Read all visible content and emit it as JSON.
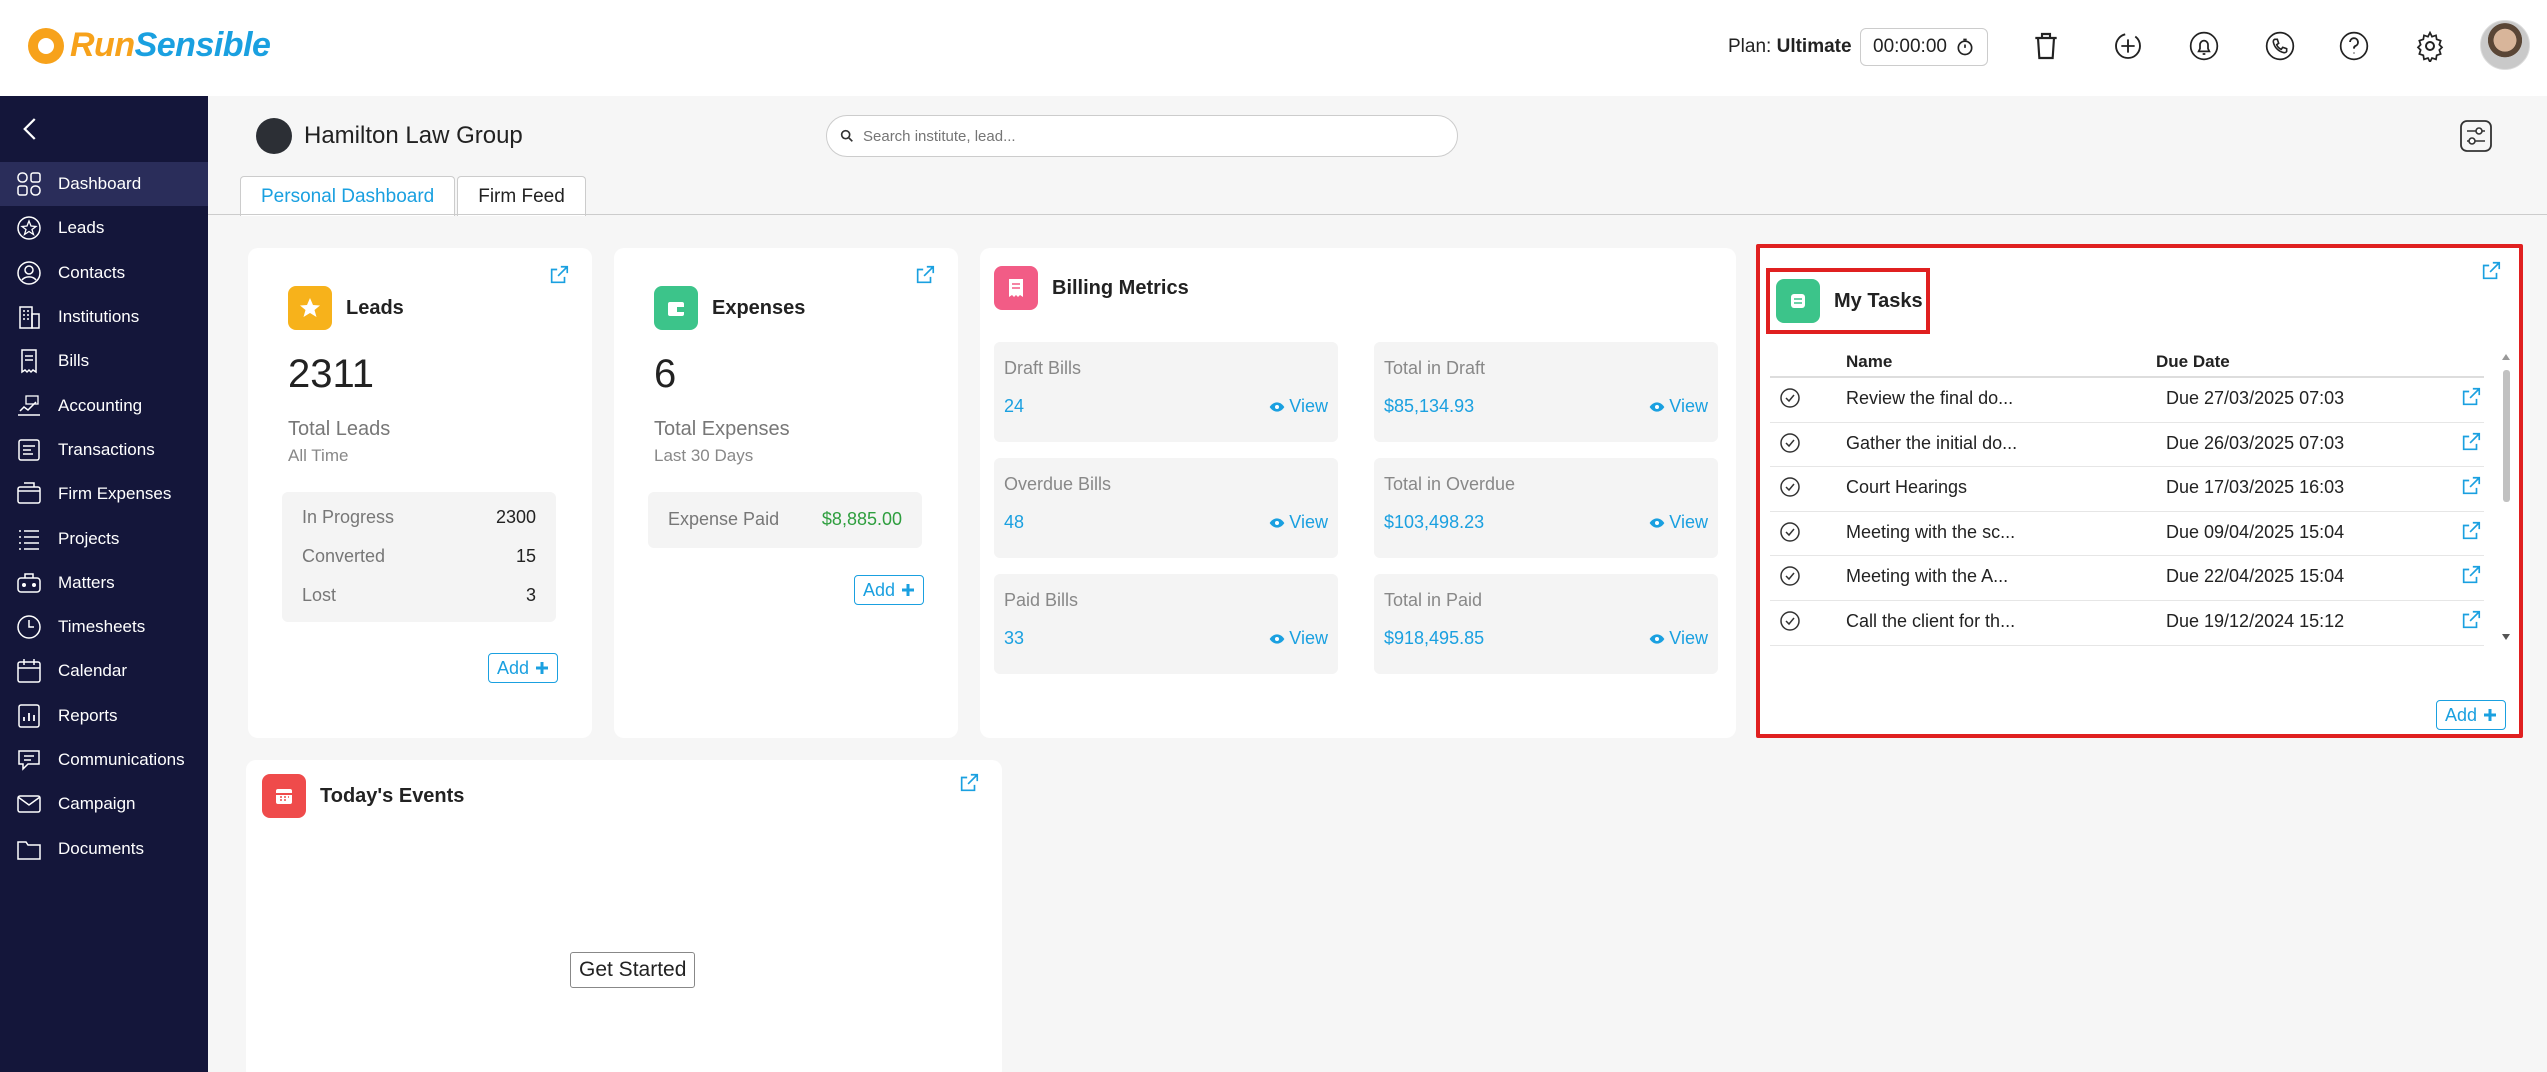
{
  "brand": {
    "run": "Run",
    "sensible": "Sensible"
  },
  "topbar": {
    "plan_prefix": "Plan:",
    "plan_name": "Ultimate",
    "timer": "00:00:00",
    "icons": [
      "trash-icon",
      "add-time-icon",
      "bell-icon",
      "phone-icon",
      "help-icon",
      "gear-icon"
    ]
  },
  "sidebar": {
    "items": [
      {
        "label": "Dashboard",
        "icon": "dashboard-icon"
      },
      {
        "label": "Leads",
        "icon": "leads-icon"
      },
      {
        "label": "Contacts",
        "icon": "contacts-icon"
      },
      {
        "label": "Institutions",
        "icon": "institutions-icon"
      },
      {
        "label": "Bills",
        "icon": "bills-icon"
      },
      {
        "label": "Accounting",
        "icon": "accounting-icon"
      },
      {
        "label": "Transactions",
        "icon": "transactions-icon"
      },
      {
        "label": "Firm Expenses",
        "icon": "firm-expenses-icon"
      },
      {
        "label": "Projects",
        "icon": "projects-icon"
      },
      {
        "label": "Matters",
        "icon": "matters-icon"
      },
      {
        "label": "Timesheets",
        "icon": "timesheets-icon"
      },
      {
        "label": "Calendar",
        "icon": "calendar-icon"
      },
      {
        "label": "Reports",
        "icon": "reports-icon"
      },
      {
        "label": "Communications",
        "icon": "communications-icon"
      },
      {
        "label": "Campaign",
        "icon": "campaign-icon"
      },
      {
        "label": "Documents",
        "icon": "documents-icon"
      }
    ]
  },
  "header": {
    "firm_name": "Hamilton Law Group",
    "search_placeholder": "Search institute, lead...",
    "tabs": [
      {
        "label": "Personal Dashboard"
      },
      {
        "label": "Firm Feed"
      }
    ]
  },
  "leads": {
    "title": "Leads",
    "count": "2311",
    "label": "Total Leads",
    "sub": "All Time",
    "stats": [
      {
        "label": "In Progress",
        "value": "2300"
      },
      {
        "label": "Converted",
        "value": "15"
      },
      {
        "label": "Lost",
        "value": "3"
      }
    ],
    "add_label": "Add"
  },
  "expenses": {
    "title": "Expenses",
    "count": "6",
    "label": "Total Expenses",
    "sub": "Last 30 Days",
    "paid_label": "Expense Paid",
    "paid_value": "$8,885.00",
    "add_label": "Add"
  },
  "billing": {
    "title": "Billing Metrics",
    "view_label": "View",
    "boxes": [
      {
        "label": "Draft Bills",
        "value": "24"
      },
      {
        "label": "Total in Draft",
        "value": "$85,134.93"
      },
      {
        "label": "Overdue Bills",
        "value": "48"
      },
      {
        "label": "Total in Overdue",
        "value": "$103,498.23"
      },
      {
        "label": "Paid Bills",
        "value": "33"
      },
      {
        "label": "Total in Paid",
        "value": "$918,495.85"
      }
    ]
  },
  "tasks": {
    "title": "My Tasks",
    "col_name": "Name",
    "col_due": "Due Date",
    "rows": [
      {
        "name": "Review the final do...",
        "due": "Due 27/03/2025 07:03"
      },
      {
        "name": "Gather the initial do...",
        "due": "Due 26/03/2025 07:03"
      },
      {
        "name": "Court Hearings",
        "due": "Due 17/03/2025 16:03"
      },
      {
        "name": "Meeting with the sc...",
        "due": "Due 09/04/2025 15:04"
      },
      {
        "name": "Meeting with the A...",
        "due": "Due 22/04/2025 15:04"
      },
      {
        "name": "Call the client for th...",
        "due": "Due 19/12/2024 15:12"
      }
    ],
    "add_label": "Add"
  },
  "events": {
    "title": "Today's Events",
    "button": "Get Started"
  },
  "colors": {
    "accent": "#1aa0e0",
    "sidebar": "#14163a",
    "brand_orange": "#f7a21b",
    "highlight_red": "#e02020",
    "money_green": "#2e9e3e"
  }
}
